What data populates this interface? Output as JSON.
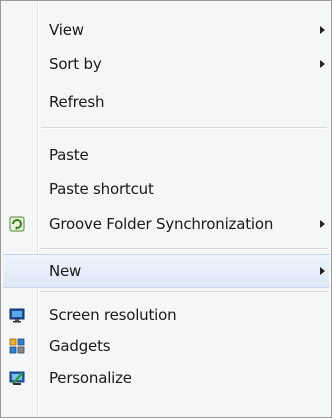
{
  "context_menu": {
    "items": [
      {
        "label": "View",
        "has_submenu": true
      },
      {
        "label": "Sort by",
        "has_submenu": true
      },
      {
        "label": "Refresh",
        "has_submenu": false
      },
      {
        "label": "Paste",
        "has_submenu": false
      },
      {
        "label": "Paste shortcut",
        "has_submenu": false
      },
      {
        "label": "Groove Folder Synchronization",
        "has_submenu": true,
        "icon": "groove-icon"
      },
      {
        "label": "New",
        "has_submenu": true,
        "highlighted": true
      },
      {
        "label": "Screen resolution",
        "has_submenu": false,
        "icon": "display-icon"
      },
      {
        "label": "Gadgets",
        "has_submenu": false,
        "icon": "gadgets-icon"
      },
      {
        "label": "Personalize",
        "has_submenu": false,
        "icon": "personalize-icon"
      }
    ]
  },
  "colors": {
    "menu_background": "#f5f6f8",
    "highlight": "#dfe8f6",
    "separator": "#d7d8da"
  }
}
